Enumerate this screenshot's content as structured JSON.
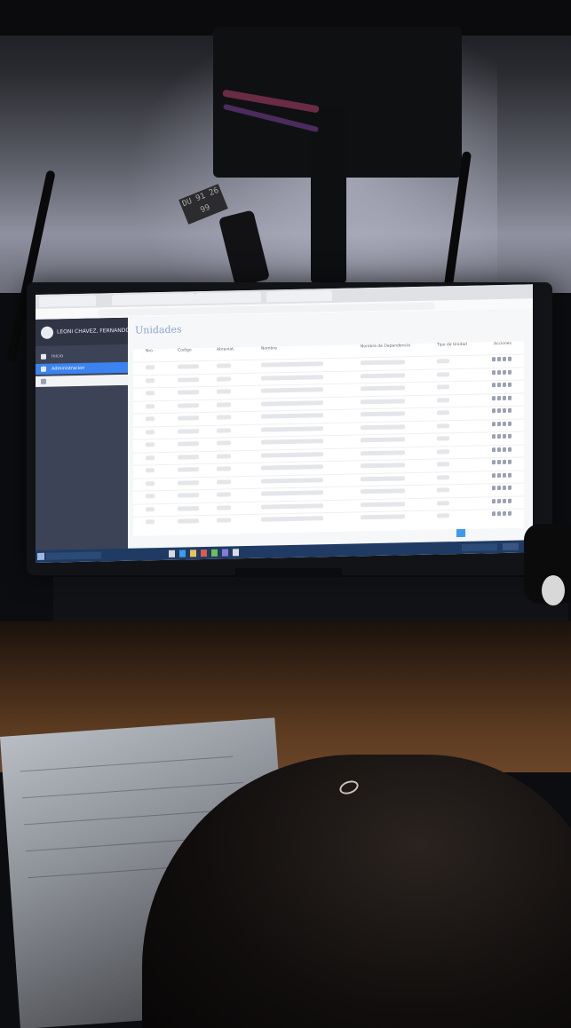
{
  "browser": {
    "tabs": [
      "",
      "",
      "",
      ""
    ]
  },
  "app": {
    "user_name": "LEONI CHAVEZ, FERNANDO",
    "page_title": "Unidades",
    "sidebar": {
      "items": [
        {
          "label": "Inicio",
          "icon": "home-icon"
        },
        {
          "label": "Administracion",
          "icon": "folder-icon"
        },
        {
          "label": "",
          "icon": "list-icon"
        }
      ]
    },
    "table": {
      "headers": [
        "Nro",
        "Codigo",
        "Abreviat.",
        "Nombre",
        "Nombre de Dependencia",
        "Tipo de Unidad",
        "Acciones"
      ],
      "row_count": 13
    }
  },
  "colors": {
    "sidebar": "#3c4356",
    "active_item": "#3b83f0",
    "taskbar": "#1f3b64",
    "title": "#8aa6cc"
  },
  "scene": {
    "tag_text": "DU 91\n26 99"
  }
}
